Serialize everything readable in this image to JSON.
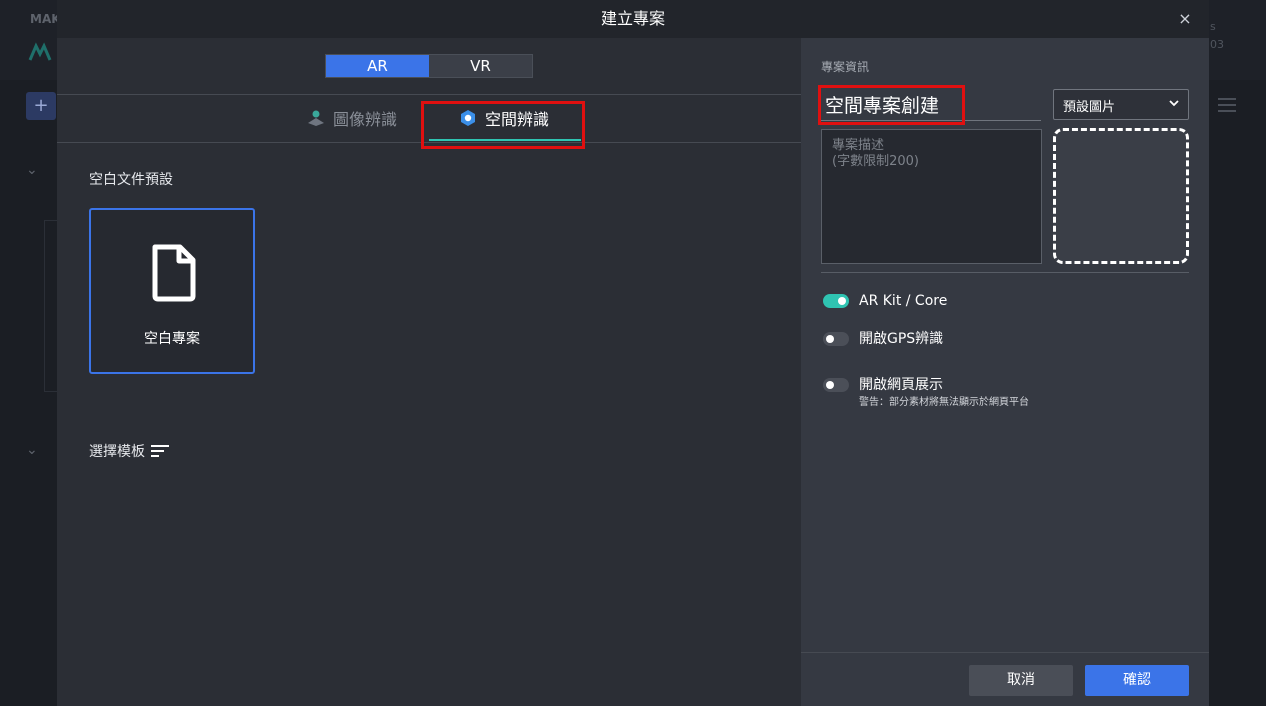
{
  "background": {
    "logo_text": "MAK",
    "right_text_1": "s",
    "right_text_2": "03",
    "plus_label": "+"
  },
  "modal": {
    "title": "建立專案",
    "close_label": "×"
  },
  "mode_toggle": {
    "ar_label": "AR",
    "vr_label": "VR",
    "selected": "AR"
  },
  "tabs": [
    {
      "label": "圖像辨識",
      "icon": "image-recognition-icon",
      "active": false
    },
    {
      "label": "空間辨識",
      "icon": "space-recognition-icon",
      "active": true
    }
  ],
  "left": {
    "blank_section_label": "空白文件預設",
    "blank_card_label": "空白專案",
    "template_section_label": "選擇模板"
  },
  "right": {
    "info_label": "專案資訊",
    "project_name": "空間專案創建",
    "description_placeholder": "專案描述\n(字數限制200)",
    "image_select_value": "預設圖片",
    "toggles": [
      {
        "label": "AR Kit / Core",
        "on": true,
        "sub": ""
      },
      {
        "label": "開啟GPS辨識",
        "on": false,
        "sub": ""
      },
      {
        "label": "開啟網頁展示",
        "on": false,
        "sub": "警告：部分素材將無法顯示於網頁平台"
      }
    ],
    "cancel_label": "取消",
    "confirm_label": "確認"
  },
  "colors": {
    "accent_blue": "#3b74e8",
    "teal": "#2fc4b2",
    "highlight_red": "#e01010"
  }
}
